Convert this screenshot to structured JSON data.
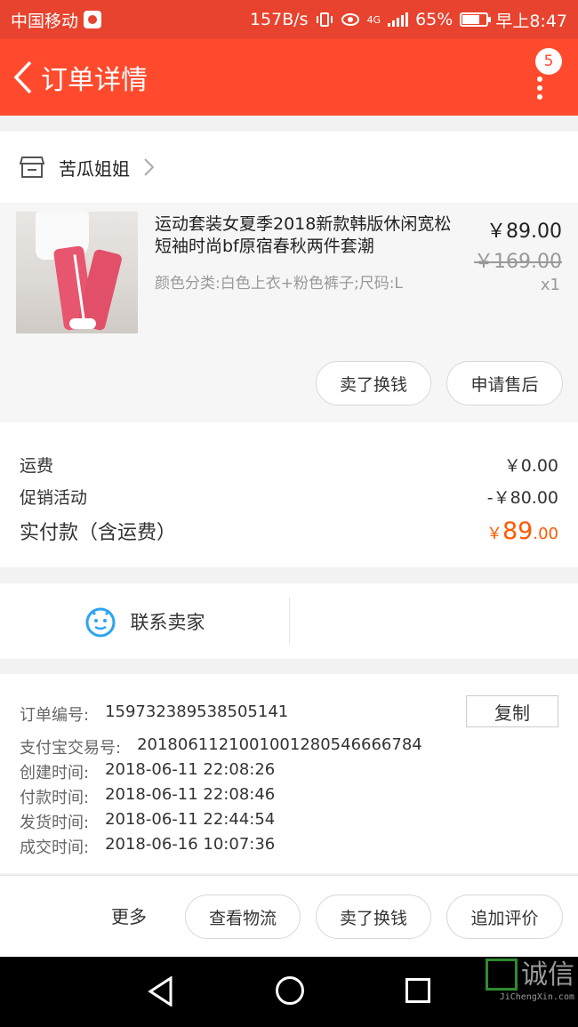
{
  "status_bar": {
    "carrier": "中国移动",
    "speed": "157B/s",
    "network": "4G",
    "battery": "65%",
    "battery_level": 0.65,
    "time": "早上8:47"
  },
  "header": {
    "title": "订单详情",
    "badge_count": "5"
  },
  "shop": {
    "name": "苦瓜姐姐"
  },
  "product": {
    "title": "运动套装女夏季2018新款韩版休闲宽松短袖时尚bf原宿春秋两件套潮",
    "sku": "颜色分类:白色上衣+粉色裤子;尺码:L",
    "price": "￥89.00",
    "original_price": "￥169.00",
    "quantity": "x1",
    "buttons": {
      "sell": "卖了换钱",
      "after_sale": "申请售后"
    }
  },
  "fees": {
    "shipping_label": "运费",
    "shipping_value": "￥0.00",
    "promo_label": "促销活动",
    "promo_value": "-￥80.00",
    "total_label": "实付款（含运费）",
    "total_currency": "￥",
    "total_int": "89",
    "total_dec": ".00"
  },
  "contact": {
    "label": "联系卖家"
  },
  "order_info": {
    "order_no_label": "订单编号:",
    "order_no": "159732389538505141",
    "copy_label": "复制",
    "alipay_label": "支付宝交易号:",
    "alipay_no": "2018061121001001280546666784",
    "created_label": "创建时间:",
    "created": "2018-06-11 22:08:26",
    "paid_label": "付款时间:",
    "paid": "2018-06-11 22:08:46",
    "shipped_label": "发货时间:",
    "shipped": "2018-06-11 22:44:54",
    "completed_label": "成交时间:",
    "completed": "2018-06-16 10:07:36"
  },
  "bottom_actions": {
    "more": "更多",
    "logistics": "查看物流",
    "sell": "卖了换钱",
    "review": "追加评价"
  },
  "watermark": {
    "text": "诚信",
    "sub": "JiChengXin.com"
  },
  "colors": {
    "brand": "#ff4a2d",
    "accent_price": "#ff5a00"
  }
}
